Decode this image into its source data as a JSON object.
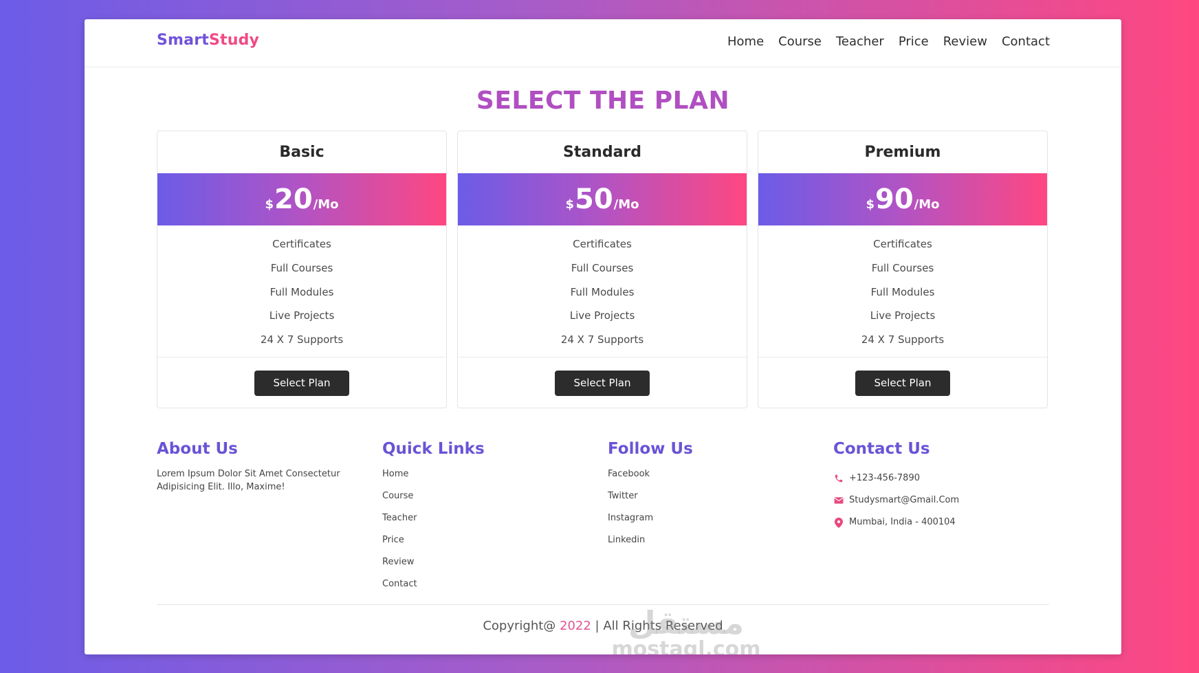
{
  "brand": {
    "part1": "Smart",
    "part2": "Study"
  },
  "nav": [
    "Home",
    "Course",
    "Teacher",
    "Price",
    "Review",
    "Contact"
  ],
  "page_title": "SELECT THE PLAN",
  "plans": [
    {
      "name": "Basic",
      "currency": "$",
      "amount": "20",
      "period": "/Mo",
      "features": [
        "Certificates",
        "Full Courses",
        "Full Modules",
        "Live Projects",
        "24 X 7 Supports"
      ],
      "button": "Select Plan"
    },
    {
      "name": "Standard",
      "currency": "$",
      "amount": "50",
      "period": "/Mo",
      "features": [
        "Certificates",
        "Full Courses",
        "Full Modules",
        "Live Projects",
        "24 X 7 Supports"
      ],
      "button": "Select Plan"
    },
    {
      "name": "Premium",
      "currency": "$",
      "amount": "90",
      "period": "/Mo",
      "features": [
        "Certificates",
        "Full Courses",
        "Full Modules",
        "Live Projects",
        "24 X 7 Supports"
      ],
      "button": "Select Plan"
    }
  ],
  "footer": {
    "about": {
      "title": "About Us",
      "text": "Lorem Ipsum Dolor Sit Amet Consectetur Adipisicing Elit. Illo, Maxime!"
    },
    "quick_links": {
      "title": "Quick Links",
      "items": [
        "Home",
        "Course",
        "Teacher",
        "Price",
        "Review",
        "Contact"
      ]
    },
    "follow": {
      "title": "Follow Us",
      "items": [
        "Facebook",
        "Twitter",
        "Instagram",
        "Linkedin"
      ]
    },
    "contact": {
      "title": "Contact Us",
      "phone": "+123-456-7890",
      "email": "Studysmart@Gmail.Com",
      "address": "Mumbai, India - 400104"
    }
  },
  "copyright": {
    "prefix": "Copyright@ ",
    "year": "2022",
    "suffix": " | All Rights Reserved"
  },
  "watermark": {
    "arabic": "مستقل",
    "latin": "mostaql.com"
  },
  "colors": {
    "brand_purple": "#6c5ce7",
    "brand_pink": "#ff4781",
    "title": "#b04fc1",
    "button": "#2c2c2c"
  }
}
